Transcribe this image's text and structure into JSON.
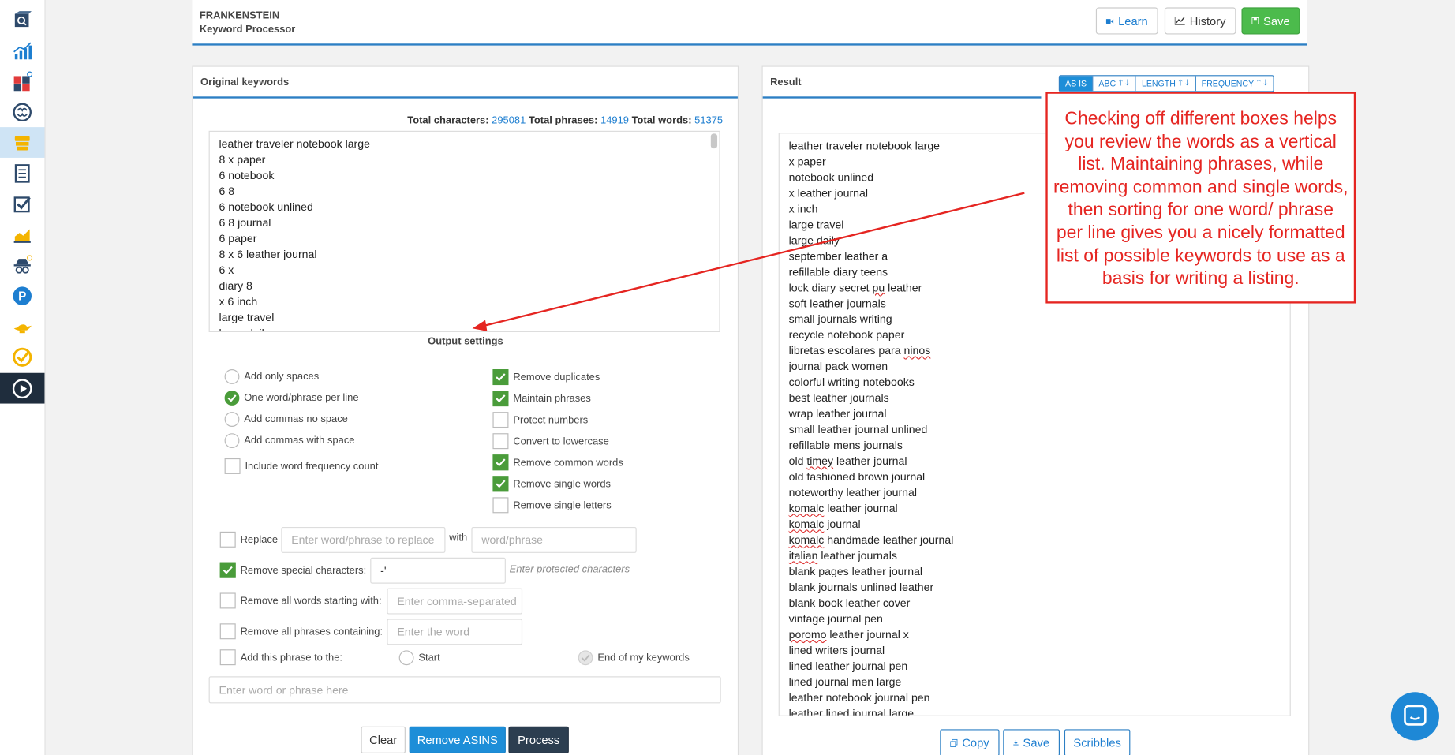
{
  "header": {
    "brand": "FRANKENSTEIN",
    "subtitle": "Keyword Processor",
    "learn_label": "Learn",
    "history_label": "History",
    "save_label": "Save"
  },
  "sidebar": {
    "items": [
      {
        "icon": "search-box-icon"
      },
      {
        "icon": "bar-chart-icon"
      },
      {
        "icon": "puzzle-icon"
      },
      {
        "icon": "brain-icon"
      },
      {
        "icon": "frankenstein-icon"
      },
      {
        "icon": "document-icon"
      },
      {
        "icon": "checkbox-icon"
      },
      {
        "icon": "area-chart-icon"
      },
      {
        "icon": "spy-icon"
      },
      {
        "icon": "p-badge-icon"
      },
      {
        "icon": "genie-lamp-icon"
      },
      {
        "icon": "check-circle-icon"
      },
      {
        "icon": "play-icon"
      }
    ]
  },
  "original": {
    "title": "Original keywords",
    "total_characters_label": "Total characters:",
    "total_characters": "295081",
    "total_phrases_label": "Total phrases:",
    "total_phrases": "14919",
    "total_words_label": "Total words:",
    "total_words": "51375",
    "lines": [
      "leather traveler notebook large",
      "8 x paper",
      "6 notebook",
      "6 8",
      "6 notebook unlined",
      "6 8 journal",
      "6 paper",
      "8 x 6 leather journal",
      "6 x",
      "diary 8",
      "x 6 inch",
      "large travel",
      "large daily"
    ]
  },
  "output_settings": {
    "title": "Output settings",
    "radios": [
      {
        "label": "Add only spaces",
        "checked": false
      },
      {
        "label": "One word/phrase per line",
        "checked": true
      },
      {
        "label": "Add commas no space",
        "checked": false
      },
      {
        "label": "Add commas with space",
        "checked": false
      }
    ],
    "include_frequency": {
      "label": "Include word frequency count",
      "checked": false
    },
    "checks": [
      {
        "label": "Remove duplicates",
        "checked": true
      },
      {
        "label": "Maintain phrases",
        "checked": true
      },
      {
        "label": "Protect numbers",
        "checked": false
      },
      {
        "label": "Convert to lowercase",
        "checked": false
      },
      {
        "label": "Remove common words",
        "checked": true
      },
      {
        "label": "Remove single words",
        "checked": true
      },
      {
        "label": "Remove single letters",
        "checked": false
      }
    ],
    "replace_label": "Replace",
    "replace_placeholder": "Enter word/phrase to replace",
    "with_label": "with",
    "with_placeholder": "word/phrase",
    "special_label": "Remove special characters:",
    "special_value": "-'",
    "special_hint": "Enter protected characters",
    "starting_label": "Remove all words starting with:",
    "starting_placeholder": "Enter comma-separated",
    "containing_label": "Remove all phrases containing:",
    "containing_placeholder": "Enter the word",
    "add_phrase_label": "Add this phrase to the:",
    "start_label": "Start",
    "end_label": "End of my keywords",
    "phrase_placeholder": "Enter word or phrase here"
  },
  "actions": {
    "clear": "Clear",
    "remove_asins": "Remove ASINS",
    "process": "Process"
  },
  "result": {
    "title": "Result",
    "sort": [
      {
        "label": "AS IS",
        "arrows": false
      },
      {
        "label": "ABC",
        "arrows": true
      },
      {
        "label": "LENGTH",
        "arrows": true
      },
      {
        "label": "FREQUENCY",
        "arrows": true
      }
    ],
    "lines": [
      "leather traveler notebook large",
      "x paper",
      "notebook unlined",
      "x  leather journal",
      "x  inch",
      "large travel",
      "large daily",
      "september leather a",
      "refillable diary teens",
      "lock diary secret pu leather",
      "soft leather journals",
      "small journals writing",
      "recycle notebook paper",
      "libretas escolares para ninos",
      "journal pack women",
      "colorful writing notebooks",
      "best leather journals",
      "wrap leather journal",
      "small leather journal unlined",
      "refillable mens journals",
      "old timey leather journal",
      "old fashioned brown journal",
      "noteworthy leather journal",
      "komalc leather journal",
      "komalc journal",
      "komalc handmade leather journal",
      "italian leather journals",
      "blank pages leather journal",
      "blank journals unlined leather",
      "blank book leather cover",
      "vintage journal pen",
      "poromo leather journal x",
      "lined writers journal",
      "lined leather journal pen",
      "lined journal men large",
      "leather notebook journal pen",
      "leather lined journal large"
    ],
    "copy": "Copy",
    "save": "Save",
    "scribbles": "Scribbles"
  },
  "callout": {
    "text": "Checking off different boxes helps you review the words as a vertical list. Maintaining phrases, while removing common and single words, then sorting for one word/ phrase per line gives you a nicely formatted list of possible keywords to use as a basis for writing a listing."
  },
  "colors": {
    "accent": "#2c7fc4",
    "save_green": "#4cbb4c",
    "check_green": "#4a9c3a",
    "annotation_red": "#e52521",
    "process_dark": "#2c3e50"
  }
}
